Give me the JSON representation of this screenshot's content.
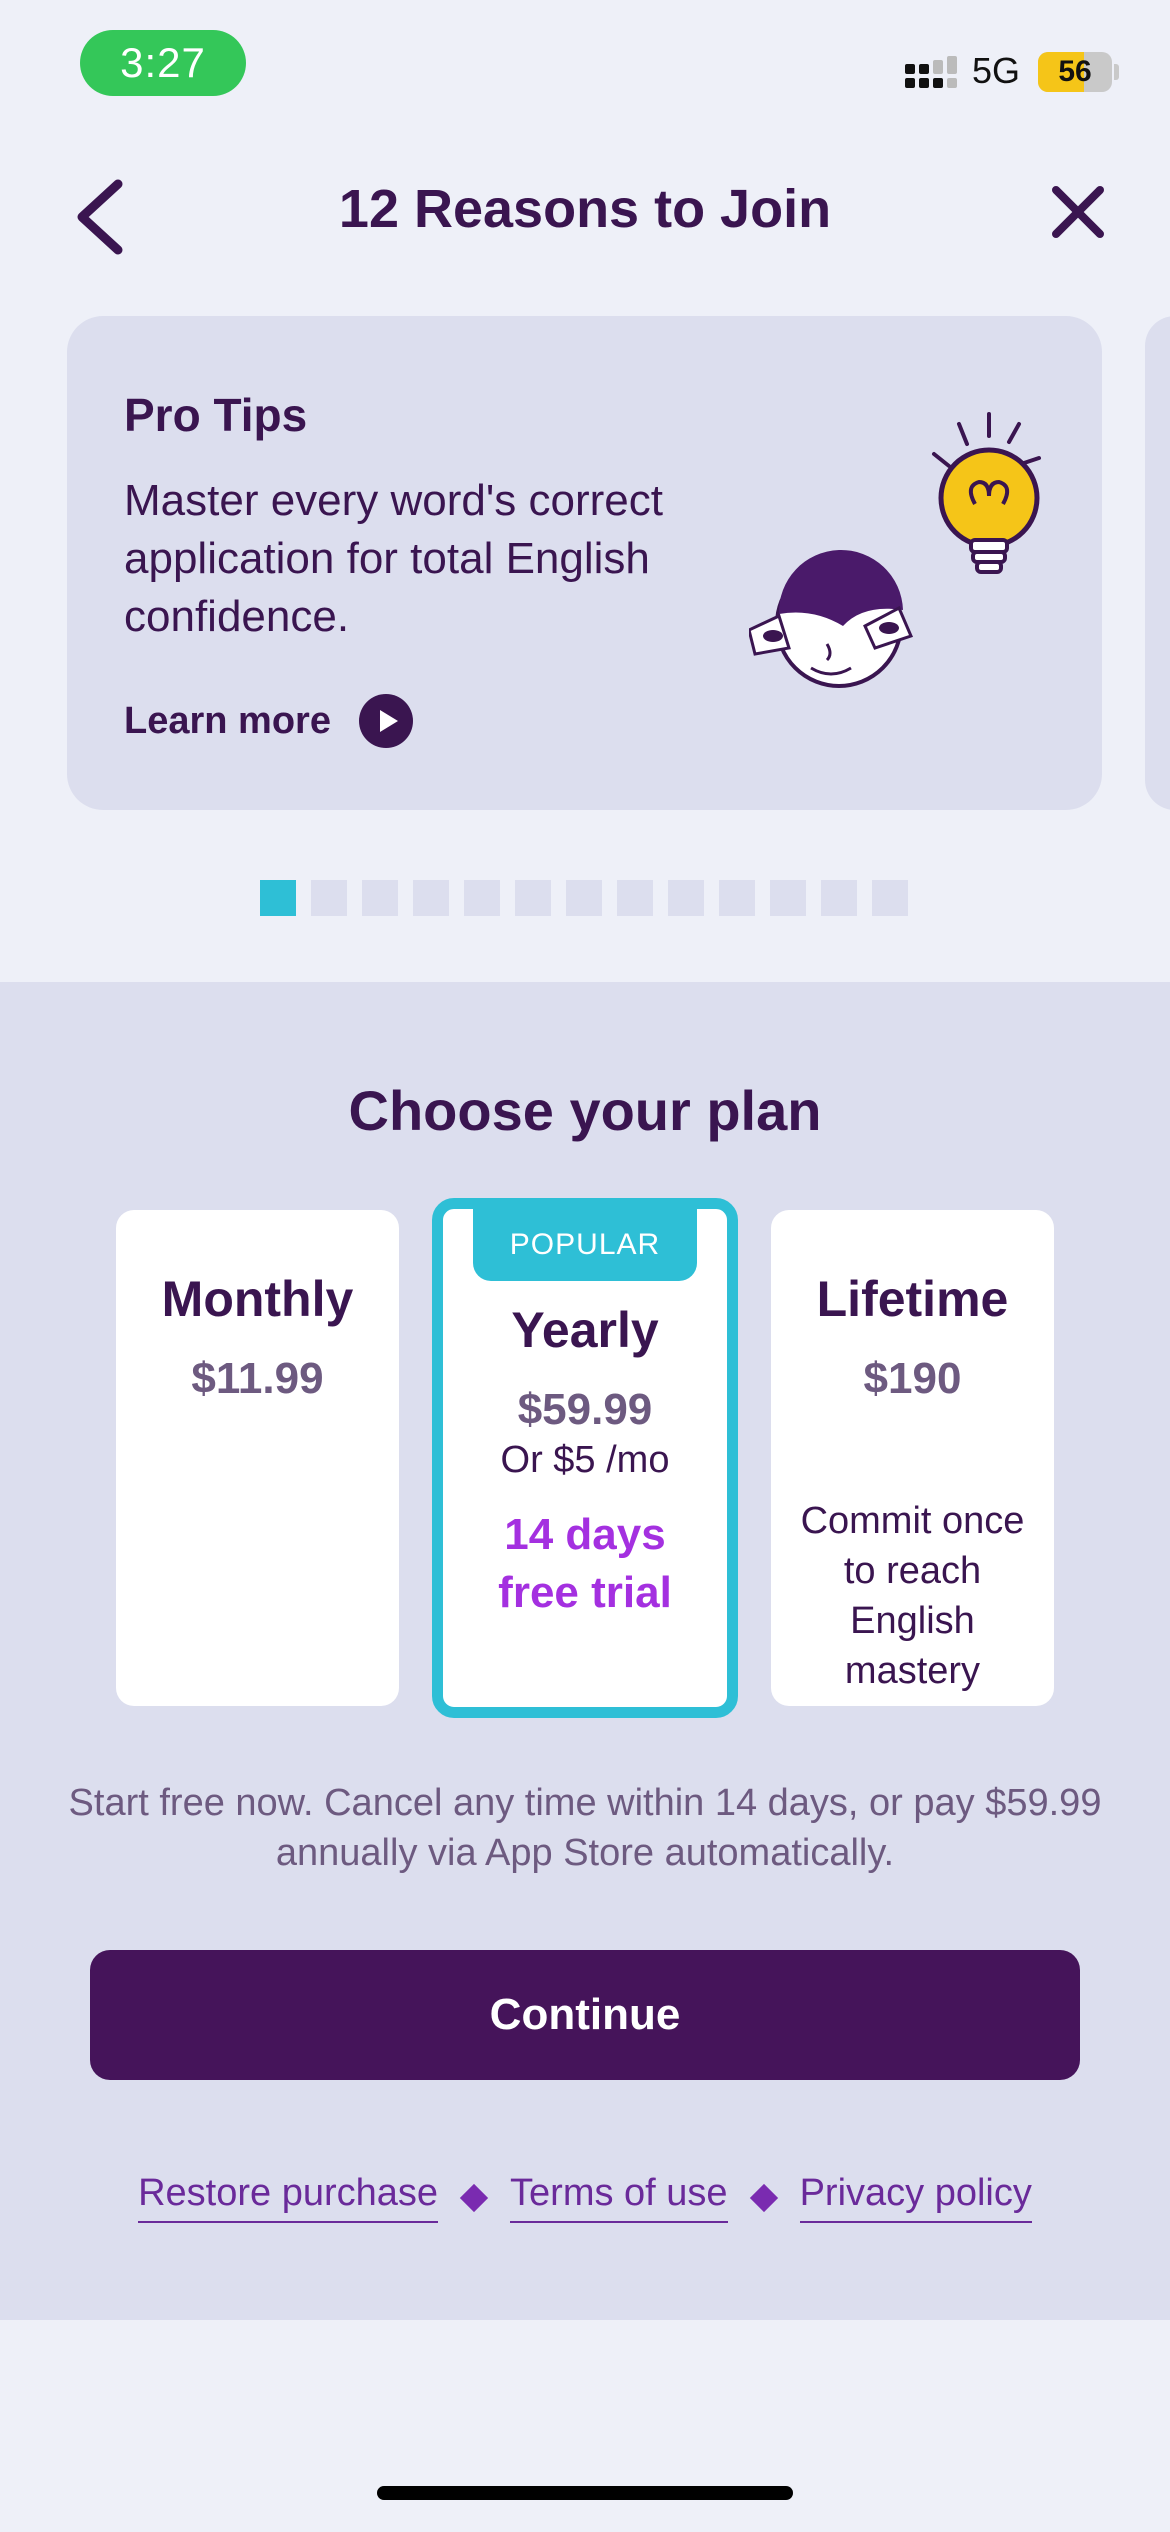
{
  "status_bar": {
    "time": "3:27",
    "network": "5G",
    "battery": "56",
    "battery_level_fraction": 0.56
  },
  "header": {
    "title": "12 Reasons to Join",
    "back_icon": "chevron-left-icon",
    "close_icon": "close-icon"
  },
  "reason_card": {
    "title": "Pro Tips",
    "body": "Master every word's correct application for total English confidence.",
    "learn_more": "Learn more",
    "play_icon": "play-icon",
    "illustration": "character-lightbulb-illustration"
  },
  "pagination": {
    "total": 13,
    "active_index": 0
  },
  "plans": {
    "heading": "Choose your plan",
    "monthly": {
      "name": "Monthly",
      "price": "$11.99"
    },
    "yearly": {
      "badge": "POPULAR",
      "name": "Yearly",
      "price": "$59.99",
      "per_month": "Or $5 /mo",
      "trial": "14 days free trial",
      "selected": true
    },
    "lifetime": {
      "name": "Lifetime",
      "price": "$190",
      "description": "Commit once to reach English mastery"
    }
  },
  "disclaimer": "Start free now. Cancel any time within 14 days, or pay $59.99 annually via App Store automatically.",
  "continue_label": "Continue",
  "footer": {
    "restore": "Restore purchase",
    "terms": "Terms of use",
    "privacy": "Privacy policy"
  },
  "colors": {
    "accent": "#2ebfd6",
    "primary": "#45145a",
    "trial": "#a430e0",
    "background": "#eef0f8",
    "panel": "#dcdeee"
  }
}
